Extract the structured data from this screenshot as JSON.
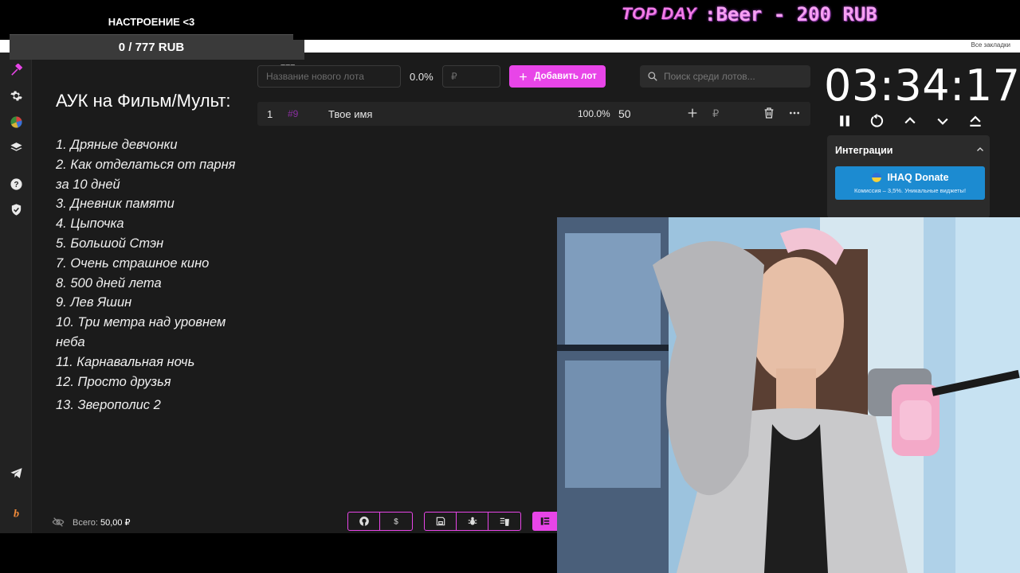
{
  "stream": {
    "top_day_label": "TOP DAY",
    "top_day_value": ":Beer - 200 RUB",
    "mood_title": "НАСТРОЕНИЕ <3",
    "mood_progress": "0 / 777 RUB",
    "mood_goal": "777"
  },
  "browser": {
    "bookmarks_label": "Все закладки"
  },
  "sidebar": {
    "items": [
      {
        "icon": "gavel-icon"
      },
      {
        "icon": "gear-icon"
      },
      {
        "icon": "wheel-icon"
      },
      {
        "icon": "layers-icon"
      },
      {
        "icon": "help-icon"
      },
      {
        "icon": "shield-icon"
      },
      {
        "icon": "telegram-icon"
      },
      {
        "icon": "brand-icon"
      }
    ]
  },
  "auction": {
    "title": "АУК на Фильм/Мульт:",
    "items": [
      "1. Дряные девчонки",
      "2. Как отделаться от парня за 10 дней",
      "3. Дневник памяти",
      "4. Цыпочка",
      "5. Большой Стэн",
      "7. Очень страшное кино",
      "8. 500 дней лета",
      "9. Лев Яшин",
      "10. Три метра над уровнем неба",
      "11. Карнавальная ночь",
      "12. Просто друзья",
      "13. Зверополис 2"
    ]
  },
  "toolbar": {
    "lot_placeholder": "Название нового лота",
    "percent": "0.0%",
    "amount_placeholder": "₽",
    "add_label": "Добавить лот",
    "search_placeholder": "Поиск среди лотов..."
  },
  "lots": [
    {
      "num": "1",
      "id": "#9",
      "name": "Твое имя",
      "percent": "100.0%",
      "amount": "50",
      "currency": "₽"
    }
  ],
  "timer": {
    "value": "03:34:17"
  },
  "integrations": {
    "title": "Интеграции",
    "ihaq_title": "IHAQ Donate",
    "ihaq_sub": "Комиссия – 3,5%. Уникальные виджеты!"
  },
  "footer": {
    "total_label": "Всего:",
    "total_value": "50,00 ₽"
  },
  "colors": {
    "accent": "#e845e8",
    "ihaq": "#1c8bd1",
    "background": "#1b1b1b"
  }
}
